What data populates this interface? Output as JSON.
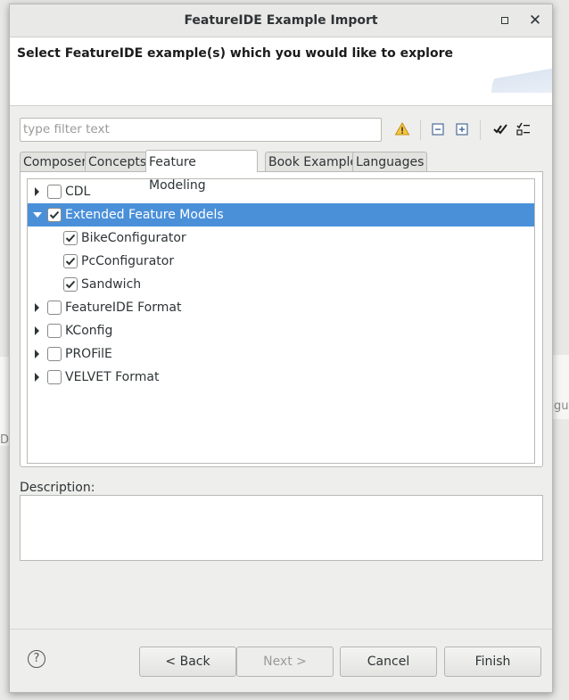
{
  "background": {
    "left_fragment": "DE",
    "right_fragment": "gu"
  },
  "dialog": {
    "title": "FeatureIDE Example Import",
    "banner_message": "Select FeatureIDE example(s) which you would like to explore"
  },
  "filter": {
    "placeholder": "type filter text",
    "value": ""
  },
  "toolbar_icons": [
    "warning-icon",
    "collapse-all-icon",
    "expand-all-icon",
    "select-all-icon",
    "deselect-all-icon"
  ],
  "tabs": [
    {
      "label": "Composer"
    },
    {
      "label": "Concepts"
    },
    {
      "label": "Feature Modeling",
      "active": true
    },
    {
      "label": "Book Example"
    },
    {
      "label": "Languages"
    }
  ],
  "tree": {
    "items": [
      {
        "label": "CDL",
        "checked": false,
        "expanded": false
      },
      {
        "label": "Extended Feature Models",
        "checked": true,
        "expanded": true,
        "selected": true
      },
      {
        "label": "BikeConfigurator",
        "checked": true,
        "child": true
      },
      {
        "label": "PcConfigurator",
        "checked": true,
        "child": true
      },
      {
        "label": "Sandwich",
        "checked": true,
        "child": true
      },
      {
        "label": "FeatureIDE Format",
        "checked": false,
        "expanded": false
      },
      {
        "label": "KConfig",
        "checked": false,
        "expanded": false
      },
      {
        "label": "PROFilE",
        "checked": false,
        "expanded": false
      },
      {
        "label": "VELVET Format",
        "checked": false,
        "expanded": false
      }
    ]
  },
  "description": {
    "label": "Description:",
    "value": ""
  },
  "buttons": {
    "help": "?",
    "back": "< Back",
    "next": "Next >",
    "cancel": "Cancel",
    "finish": "Finish"
  },
  "colors": {
    "selection": "#4a90d9",
    "dialog_bg": "#eeeeec"
  }
}
